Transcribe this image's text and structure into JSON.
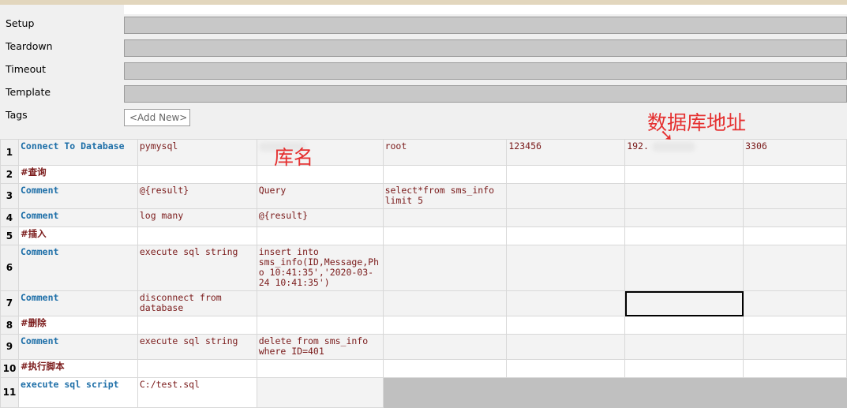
{
  "settings": {
    "setup_label": "Setup",
    "teardown_label": "Teardown",
    "timeout_label": "Timeout",
    "template_label": "Template",
    "tags_label": "Tags",
    "add_new_label": "<Add New>"
  },
  "annotations": {
    "db_name": "库名",
    "db_address": "数据库地址",
    "arrow": "➘"
  },
  "rows": [
    {
      "num": "1",
      "c0": "Connect To Database",
      "c1": "pymysql",
      "c2": "",
      "c3": "root",
      "c4": "123456",
      "c5": "192.",
      "c6": "3306"
    },
    {
      "num": "2",
      "c0": "#查询"
    },
    {
      "num": "3",
      "c0": "Comment",
      "c1": "@{result}",
      "c2": "Query",
      "c3": "select*from sms_info limit 5"
    },
    {
      "num": "4",
      "c0": "Comment",
      "c1": "log many",
      "c2": "@{result}"
    },
    {
      "num": "5",
      "c0": "#插入"
    },
    {
      "num": "6",
      "c0": "Comment",
      "c1": "execute sql string",
      "c2": "insert into sms_info(ID,Message,Pho 10:41:35','2020-03-24 10:41:35')"
    },
    {
      "num": "7",
      "c0": "Comment",
      "c1": "disconnect from database"
    },
    {
      "num": "8",
      "c0": "#删除"
    },
    {
      "num": "9",
      "c0": "Comment",
      "c1": "execute sql string",
      "c2": "delete from sms_info where ID=401"
    },
    {
      "num": "10",
      "c0": "#执行脚本"
    },
    {
      "num": "11",
      "c0": "execute sql script",
      "c1": "C:/test.sql"
    }
  ]
}
